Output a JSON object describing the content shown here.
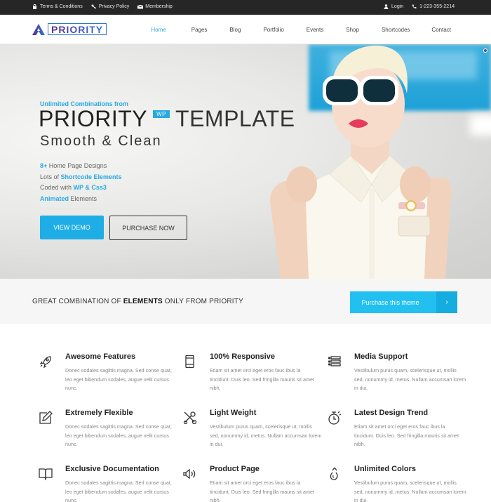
{
  "topbar": {
    "left_links": [
      {
        "label": "Terms & Conditions",
        "icon": "lock-icon"
      },
      {
        "label": "Privacy Policy",
        "icon": "key-icon"
      },
      {
        "label": "Membership",
        "icon": "envelope-icon"
      }
    ],
    "right_links": [
      {
        "label": "Login",
        "icon": "user-icon"
      },
      {
        "label": "1-223-355-2214",
        "icon": "phone-icon"
      }
    ]
  },
  "header": {
    "logo_text": "PRIORITY",
    "nav": [
      {
        "label": "Home",
        "active": true
      },
      {
        "label": "Pages"
      },
      {
        "label": "Blog"
      },
      {
        "label": "Portfolio"
      },
      {
        "label": "Events"
      },
      {
        "label": "Shop"
      },
      {
        "label": "Shortcodes"
      },
      {
        "label": "Contact"
      }
    ]
  },
  "hero": {
    "subtitle": "Unlimited Combinations from",
    "title_part1": "PRIORITY",
    "badge": "WP",
    "title_part2": "TEMPLATE",
    "tagline": "Smooth & Clean",
    "list": [
      {
        "highlight": "8+",
        "text": " Home Page Designs",
        "highlight_first": true
      },
      {
        "text": "Lots of ",
        "highlight": "Shortcode Elements",
        "highlight_first": false
      },
      {
        "text": "Coded with ",
        "highlight": "WP & Css3",
        "highlight_first": false
      },
      {
        "highlight": "Animated",
        "text": " Elements",
        "highlight_first": true
      }
    ],
    "btn_demo": "VIEW DEMO",
    "btn_purchase": "PURCHASE NOW"
  },
  "strip": {
    "text_before": "GREAT COMBINATION OF ",
    "text_bold": "ELEMENTS",
    "text_after": " ONLY FROM PRIORITY",
    "button_label": "Purchase this theme",
    "button_arrow": "›"
  },
  "features": [
    {
      "icon": "rocket-icon",
      "title": "Awesome Features",
      "desc": "Donec sodales sagittis magna. Sed conse quat, leo eget bibendum sodales, augue velit cursus nunc."
    },
    {
      "icon": "mobile-icon",
      "title": "100% Responsive",
      "desc": "Etiam sit amet orci eget eros fauc ibus la tincidunt. Duis leo. Sed fringilla mauris sit amet nibh."
    },
    {
      "icon": "list-icon",
      "title": "Media Support",
      "desc": "Vestibulum purus quam, scelerisque ut, mollis sed, nonummy id, metus. Nullam accumsan lorem in dui."
    },
    {
      "icon": "edit-icon",
      "title": "Extremely Flexible",
      "desc": "Donec sodales sagittis magna. Sed conse quat, leo eget bibendum sodales, augue velit cursus nunc."
    },
    {
      "icon": "tools-icon",
      "title": "Light Weight",
      "desc": "Vestibulum purus quam, scelerisque ut, mollis sed, nonummy id, metus. Nullam accumsan lorem in dui."
    },
    {
      "icon": "stopwatch-icon",
      "title": "Latest Design Trend",
      "desc": "Etiam sit amet orci eget eros fauc ibus la tincidunt. Duis leo. Sed fringilla mauris sit amet nibh."
    },
    {
      "icon": "book-icon",
      "title": "Exclusive Documentation",
      "desc": "Donec sodales sagittis magna. Sed conse quat, leo eget bibendum sodales, augue velit cursus nunc."
    },
    {
      "icon": "speaker-icon",
      "title": "Product Page",
      "desc": "Etiam sit amet orci eget eros fauc ibus la tincidunt. Duis leo. Sed fringilla mauris sit amet nibh."
    },
    {
      "icon": "drop-icon",
      "title": "Unlimited Colors",
      "desc": "Vestibulum purus quam, scelerisque ut, mollis sed, nonummy id, metus. Nullam accumsan lorem in dui."
    }
  ],
  "colors": {
    "accent": "#27a9e1",
    "topbar": "#262626",
    "strip_button": "#22c0f1"
  }
}
